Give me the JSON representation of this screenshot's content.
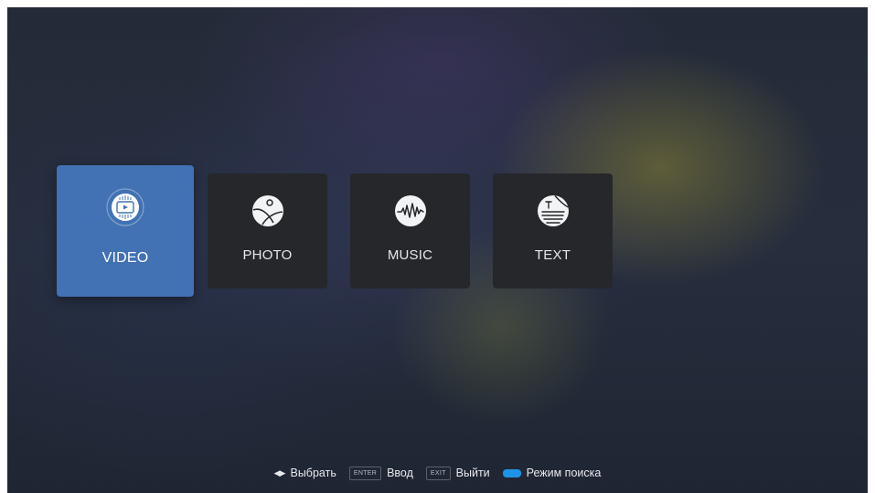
{
  "colors": {
    "selected_tile": "#4272b3",
    "tile": "#26272b",
    "search_mode_key": "#1f93e6"
  },
  "tiles": [
    {
      "label": "VIDEO",
      "icon": "video-play-icon",
      "selected": true
    },
    {
      "label": "PHOTO",
      "icon": "photo-icon",
      "selected": false
    },
    {
      "label": "MUSIC",
      "icon": "music-waveform-icon",
      "selected": false
    },
    {
      "label": "TEXT",
      "icon": "text-document-icon",
      "selected": false
    }
  ],
  "hints": {
    "select": {
      "icon": "left-right-arrows-icon",
      "label": "Выбрать"
    },
    "enter": {
      "key": "ENTER",
      "label": "Ввод"
    },
    "exit": {
      "key": "EXIT",
      "label": "Выйти"
    },
    "search": {
      "icon": "blue-key-icon",
      "label": "Режим поиска"
    }
  }
}
